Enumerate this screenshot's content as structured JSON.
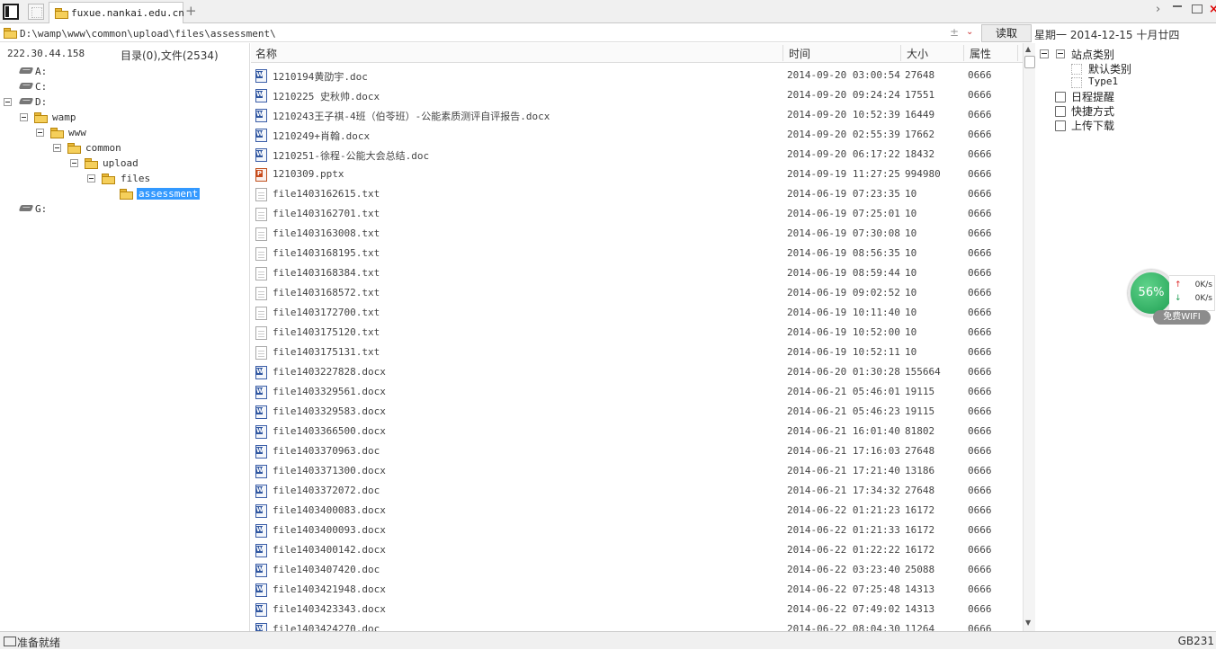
{
  "tab": {
    "label": "fuxue.nankai.edu.cn",
    "new_tab": "+"
  },
  "window": {
    "next": "›",
    "close": "×"
  },
  "address": {
    "path": "D:\\wamp\\www\\common\\upload\\files\\assessment\\",
    "plus": "±",
    "dropdown": "⌄"
  },
  "read_button": "读取",
  "date": "星期一  2014-12-15  十月廿四",
  "left": {
    "ip": "222.30.44.158",
    "dir_count": "目录(0),文件(2534)",
    "tree": [
      {
        "label": "A:",
        "type": "drive"
      },
      {
        "label": "C:",
        "type": "drive"
      },
      {
        "label": "D:",
        "type": "drive"
      },
      {
        "label": "wamp",
        "type": "folder"
      },
      {
        "label": "www",
        "type": "folder"
      },
      {
        "label": "common",
        "type": "folder"
      },
      {
        "label": "upload",
        "type": "folder"
      },
      {
        "label": "files",
        "type": "folder"
      },
      {
        "label": "assessment",
        "type": "folder"
      },
      {
        "label": "G:",
        "type": "drive"
      }
    ]
  },
  "columns": {
    "name": "名称",
    "time": "时间",
    "size": "大小",
    "attr": "属性"
  },
  "files": [
    {
      "name": "1210194黄劭宇.doc",
      "time": "2014-09-20 03:00:54",
      "size": "27648",
      "attr": "0666",
      "icon": "word-doc-icon"
    },
    {
      "name": "1210225 史秋帅.docx",
      "time": "2014-09-20 09:24:24",
      "size": "17551",
      "attr": "0666",
      "icon": "word-doc-icon"
    },
    {
      "name": "1210243王子祺-4班（伯苓班）-公能素质测评自评报告.docx",
      "time": "2014-09-20 10:52:39",
      "size": "16449",
      "attr": "0666",
      "icon": "word-doc-icon"
    },
    {
      "name": "1210249+肖翰.docx",
      "time": "2014-09-20 02:55:39",
      "size": "17662",
      "attr": "0666",
      "icon": "word-doc-icon"
    },
    {
      "name": "1210251-徐程-公能大会总结.doc",
      "time": "2014-09-20 06:17:22",
      "size": "18432",
      "attr": "0666",
      "icon": "word-doc-icon"
    },
    {
      "name": "1210309.pptx",
      "time": "2014-09-19 11:27:25",
      "size": "994980",
      "attr": "0666",
      "icon": "powerpoint-icon"
    },
    {
      "name": "file1403162615.txt",
      "time": "2014-06-19 07:23:35",
      "size": "10",
      "attr": "0666",
      "icon": "text-file-icon"
    },
    {
      "name": "file1403162701.txt",
      "time": "2014-06-19 07:25:01",
      "size": "10",
      "attr": "0666",
      "icon": "text-file-icon"
    },
    {
      "name": "file1403163008.txt",
      "time": "2014-06-19 07:30:08",
      "size": "10",
      "attr": "0666",
      "icon": "text-file-icon"
    },
    {
      "name": "file1403168195.txt",
      "time": "2014-06-19 08:56:35",
      "size": "10",
      "attr": "0666",
      "icon": "text-file-icon"
    },
    {
      "name": "file1403168384.txt",
      "time": "2014-06-19 08:59:44",
      "size": "10",
      "attr": "0666",
      "icon": "text-file-icon"
    },
    {
      "name": "file1403168572.txt",
      "time": "2014-06-19 09:02:52",
      "size": "10",
      "attr": "0666",
      "icon": "text-file-icon"
    },
    {
      "name": "file1403172700.txt",
      "time": "2014-06-19 10:11:40",
      "size": "10",
      "attr": "0666",
      "icon": "text-file-icon"
    },
    {
      "name": "file1403175120.txt",
      "time": "2014-06-19 10:52:00",
      "size": "10",
      "attr": "0666",
      "icon": "text-file-icon"
    },
    {
      "name": "file1403175131.txt",
      "time": "2014-06-19 10:52:11",
      "size": "10",
      "attr": "0666",
      "icon": "text-file-icon"
    },
    {
      "name": "file1403227828.docx",
      "time": "2014-06-20 01:30:28",
      "size": "155664",
      "attr": "0666",
      "icon": "word-doc-icon"
    },
    {
      "name": "file1403329561.docx",
      "time": "2014-06-21 05:46:01",
      "size": "19115",
      "attr": "0666",
      "icon": "word-doc-icon"
    },
    {
      "name": "file1403329583.docx",
      "time": "2014-06-21 05:46:23",
      "size": "19115",
      "attr": "0666",
      "icon": "word-doc-icon"
    },
    {
      "name": "file1403366500.docx",
      "time": "2014-06-21 16:01:40",
      "size": "81802",
      "attr": "0666",
      "icon": "word-doc-icon"
    },
    {
      "name": "file1403370963.doc",
      "time": "2014-06-21 17:16:03",
      "size": "27648",
      "attr": "0666",
      "icon": "word-doc-icon"
    },
    {
      "name": "file1403371300.docx",
      "time": "2014-06-21 17:21:40",
      "size": "13186",
      "attr": "0666",
      "icon": "word-doc-icon"
    },
    {
      "name": "file1403372072.doc",
      "time": "2014-06-21 17:34:32",
      "size": "27648",
      "attr": "0666",
      "icon": "word-doc-icon"
    },
    {
      "name": "file1403400083.docx",
      "time": "2014-06-22 01:21:23",
      "size": "16172",
      "attr": "0666",
      "icon": "word-doc-icon"
    },
    {
      "name": "file1403400093.docx",
      "time": "2014-06-22 01:21:33",
      "size": "16172",
      "attr": "0666",
      "icon": "word-doc-icon"
    },
    {
      "name": "file1403400142.docx",
      "time": "2014-06-22 01:22:22",
      "size": "16172",
      "attr": "0666",
      "icon": "word-doc-icon"
    },
    {
      "name": "file1403407420.doc",
      "time": "2014-06-22 03:23:40",
      "size": "25088",
      "attr": "0666",
      "icon": "word-doc-icon"
    },
    {
      "name": "file1403421948.docx",
      "time": "2014-06-22 07:25:48",
      "size": "14313",
      "attr": "0666",
      "icon": "word-doc-icon"
    },
    {
      "name": "file1403423343.docx",
      "time": "2014-06-22 07:49:02",
      "size": "14313",
      "attr": "0666",
      "icon": "word-doc-icon"
    },
    {
      "name": "file1403424270.doc",
      "time": "2014-06-22 08:04:30",
      "size": "11264",
      "attr": "0666",
      "icon": "word-doc-icon"
    }
  ],
  "right": {
    "site_category": "站点类别",
    "default_category": "默认类别",
    "type1": "Type1",
    "schedule": "日程提醒",
    "shortcut": "快捷方式",
    "upload_download": "上传下载"
  },
  "network": {
    "percent": "56%",
    "up": "0K/s",
    "down": "0K/s",
    "wifi": "免费WIFI",
    "up_arrow": "↑",
    "down_arrow": "↓"
  },
  "status": {
    "text": "准备就绪",
    "encoding": "GB231"
  },
  "colors": {
    "selection": "#3399ff",
    "network_green": "#1e9e52",
    "close_red": "#dd0000"
  }
}
